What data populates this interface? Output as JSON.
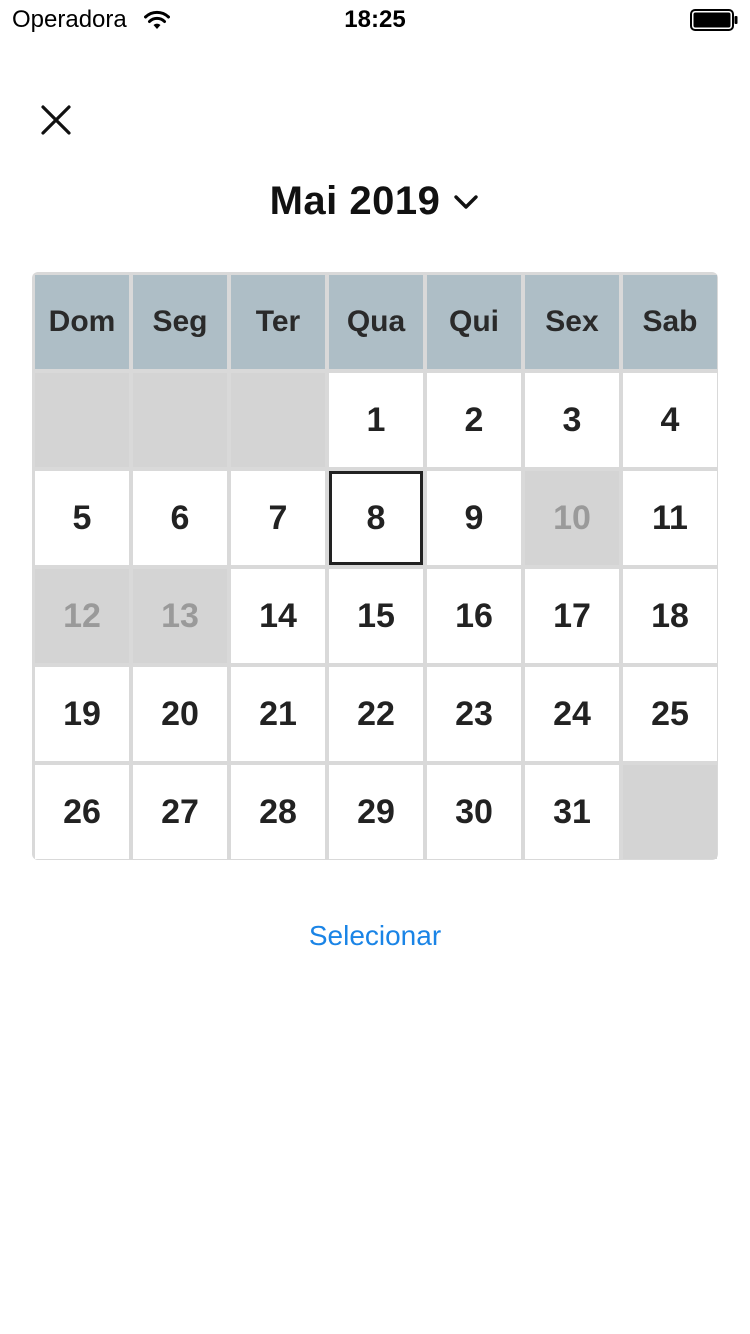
{
  "status_bar": {
    "carrier": "Operadora",
    "time": "18:25",
    "icons": [
      "wifi-icon",
      "battery-icon"
    ]
  },
  "header": {
    "close_icon": "close-icon",
    "month_title": "Mai 2019",
    "dropdown_icon": "chevron-down-icon"
  },
  "calendar": {
    "weekdays": [
      "Dom",
      "Seg",
      "Ter",
      "Qua",
      "Qui",
      "Sex",
      "Sab"
    ],
    "weeks": [
      [
        {
          "day": "",
          "state": "empty"
        },
        {
          "day": "",
          "state": "empty"
        },
        {
          "day": "",
          "state": "empty"
        },
        {
          "day": "1",
          "state": "normal"
        },
        {
          "day": "2",
          "state": "normal"
        },
        {
          "day": "3",
          "state": "normal"
        },
        {
          "day": "4",
          "state": "normal"
        }
      ],
      [
        {
          "day": "5",
          "state": "normal"
        },
        {
          "day": "6",
          "state": "normal"
        },
        {
          "day": "7",
          "state": "normal"
        },
        {
          "day": "8",
          "state": "selected"
        },
        {
          "day": "9",
          "state": "normal"
        },
        {
          "day": "10",
          "state": "disabled"
        },
        {
          "day": "11",
          "state": "normal"
        }
      ],
      [
        {
          "day": "12",
          "state": "disabled"
        },
        {
          "day": "13",
          "state": "disabled"
        },
        {
          "day": "14",
          "state": "normal"
        },
        {
          "day": "15",
          "state": "normal"
        },
        {
          "day": "16",
          "state": "normal"
        },
        {
          "day": "17",
          "state": "normal"
        },
        {
          "day": "18",
          "state": "normal"
        }
      ],
      [
        {
          "day": "19",
          "state": "normal"
        },
        {
          "day": "20",
          "state": "normal"
        },
        {
          "day": "21",
          "state": "normal"
        },
        {
          "day": "22",
          "state": "normal"
        },
        {
          "day": "23",
          "state": "normal"
        },
        {
          "day": "24",
          "state": "normal"
        },
        {
          "day": "25",
          "state": "normal"
        }
      ],
      [
        {
          "day": "26",
          "state": "normal"
        },
        {
          "day": "27",
          "state": "normal"
        },
        {
          "day": "28",
          "state": "normal"
        },
        {
          "day": "29",
          "state": "normal"
        },
        {
          "day": "30",
          "state": "normal"
        },
        {
          "day": "31",
          "state": "normal"
        },
        {
          "day": "",
          "state": "empty"
        }
      ]
    ]
  },
  "actions": {
    "select_label": "Selecionar"
  },
  "colors": {
    "weekday_header_bg": "#aebec6",
    "disabled_bg": "#d4d4d4",
    "link_blue": "#1a84e6"
  }
}
